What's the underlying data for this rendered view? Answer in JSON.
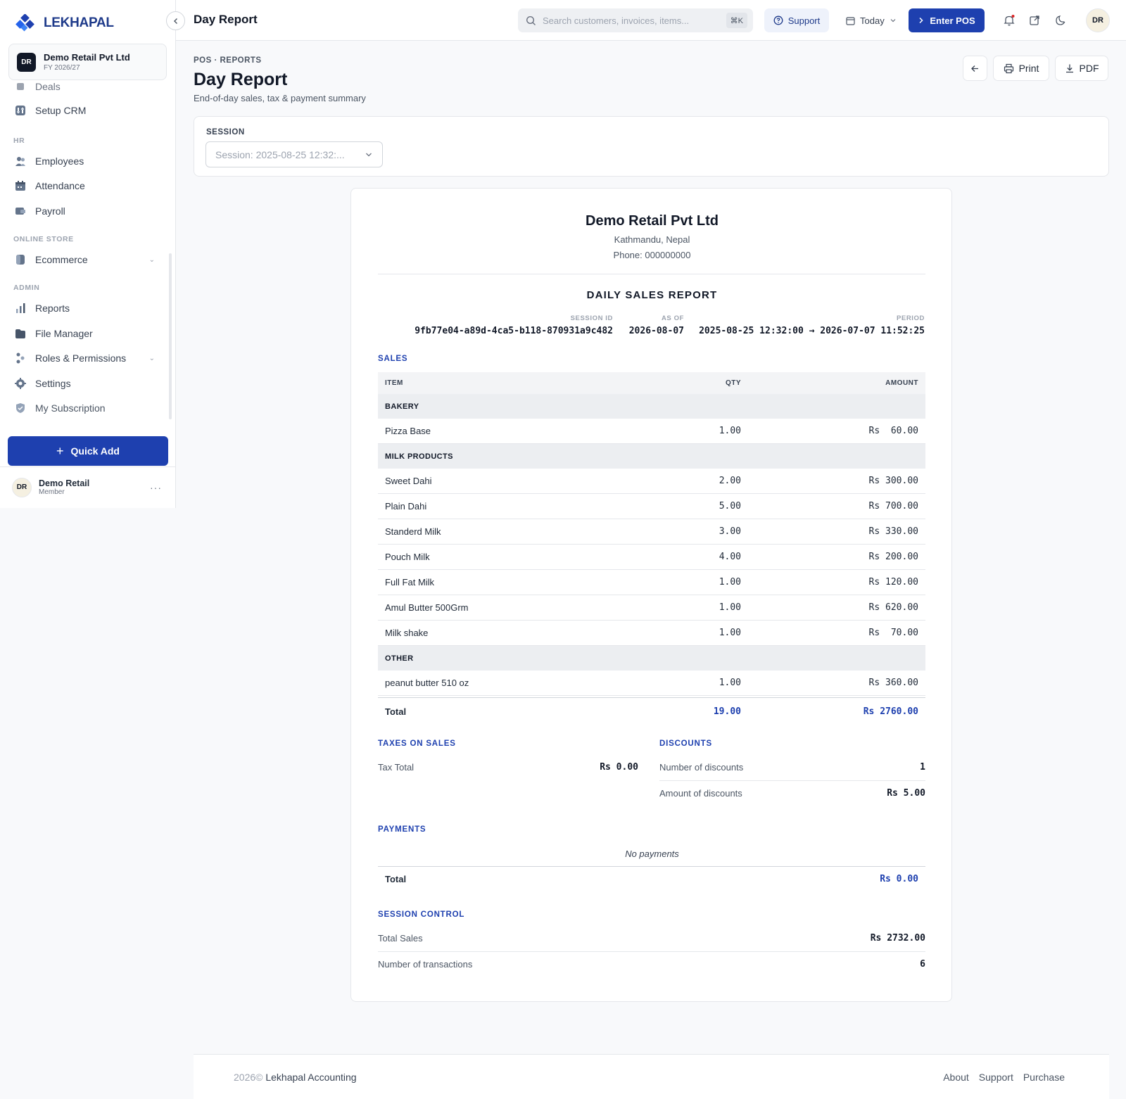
{
  "app": {
    "logo_text": "LEKHAPAL",
    "brand_color": "#1e40af"
  },
  "org": {
    "avatar": "DR",
    "name": "Demo Retail Pvt Ltd",
    "fy": "FY 2026/27"
  },
  "sidebar": {
    "partial_item": "Deals",
    "items_crm": [
      {
        "label": "Setup CRM",
        "icon": "sliders-icon"
      }
    ],
    "section_hr": "HR",
    "items_hr": [
      {
        "label": "Employees",
        "icon": "users-icon"
      },
      {
        "label": "Attendance",
        "icon": "calendar-icon"
      },
      {
        "label": "Payroll",
        "icon": "wallet-icon"
      }
    ],
    "section_store": "ONLINE STORE",
    "items_store": [
      {
        "label": "Ecommerce",
        "icon": "store-icon",
        "expandable": true
      }
    ],
    "section_admin": "ADMIN",
    "items_admin": [
      {
        "label": "Reports",
        "icon": "bar-chart-icon"
      },
      {
        "label": "File Manager",
        "icon": "folder-icon"
      },
      {
        "label": "Roles & Permissions",
        "icon": "key-icon",
        "expandable": true
      },
      {
        "label": "Settings",
        "icon": "gear-icon"
      },
      {
        "label": "My Subscription",
        "icon": "shield-icon"
      }
    ],
    "quick_add": "Quick Add",
    "user": {
      "avatar": "DR",
      "name": "Demo Retail",
      "role": "Member"
    }
  },
  "topbar": {
    "title": "Day Report",
    "search_placeholder": "Search customers, invoices, items...",
    "shortcut": "⌘K",
    "support": "Support",
    "date_filter": "Today",
    "enter_pos": "Enter POS",
    "avatar": "DR"
  },
  "page": {
    "breadcrumb": "POS · REPORTS",
    "title": "Day Report",
    "subtitle": "End-of-day sales, tax & payment summary",
    "print": "Print",
    "pdf": "PDF"
  },
  "session": {
    "label": "SESSION",
    "selected": "Session: 2025-08-25 12:32:..."
  },
  "report": {
    "company": "Demo Retail Pvt Ltd",
    "address": "Kathmandu, Nepal",
    "phone": "Phone: 000000000",
    "title": "DAILY SALES REPORT",
    "meta": {
      "session_id_label": "SESSION ID",
      "session_id": "9fb77e04-a89d-4ca5-b118-870931a9c482",
      "as_of_label": "AS OF",
      "as_of": "2026-08-07",
      "period_label": "PERIOD",
      "period": "2025-08-25 12:32:00 → 2026-07-07 11:52:25"
    },
    "sales": {
      "heading": "SALES",
      "headers": {
        "item": "ITEM",
        "qty": "QTY",
        "amount": "AMOUNT"
      },
      "rows": [
        {
          "type": "group",
          "label": "BAKERY"
        },
        {
          "type": "item",
          "item": "Pizza Base",
          "qty": "1.00",
          "amount": "Rs  60.00"
        },
        {
          "type": "group",
          "label": "MILK PRODUCTS"
        },
        {
          "type": "item",
          "item": "Sweet Dahi",
          "qty": "2.00",
          "amount": "Rs 300.00"
        },
        {
          "type": "item",
          "item": "Plain Dahi",
          "qty": "5.00",
          "amount": "Rs 700.00"
        },
        {
          "type": "item",
          "item": "Standerd Milk",
          "qty": "3.00",
          "amount": "Rs 330.00"
        },
        {
          "type": "item",
          "item": "Pouch Milk",
          "qty": "4.00",
          "amount": "Rs 200.00"
        },
        {
          "type": "item",
          "item": "Full Fat Milk",
          "qty": "1.00",
          "amount": "Rs 120.00"
        },
        {
          "type": "item",
          "item": "Amul Butter 500Grm",
          "qty": "1.00",
          "amount": "Rs 620.00"
        },
        {
          "type": "item",
          "item": "Milk shake",
          "qty": "1.00",
          "amount": "Rs  70.00"
        },
        {
          "type": "group",
          "label": "OTHER"
        },
        {
          "type": "item",
          "item": "peanut butter 510 oz",
          "qty": "1.00",
          "amount": "Rs 360.00"
        }
      ],
      "total_label": "Total",
      "total_qty": "19.00",
      "total_amount": "Rs 2760.00"
    },
    "taxes": {
      "heading": "TAXES ON SALES",
      "label": "Tax Total",
      "value": "Rs 0.00"
    },
    "discounts": {
      "heading": "DISCOUNTS",
      "count_label": "Number of discounts",
      "count": "1",
      "amount_label": "Amount of discounts",
      "amount": "Rs 5.00"
    },
    "payments": {
      "heading": "PAYMENTS",
      "empty": "No payments",
      "total_label": "Total",
      "total": "Rs 0.00"
    },
    "session_control": {
      "heading": "SESSION CONTROL",
      "sales_label": "Total Sales",
      "sales": "Rs 2732.00",
      "tx_label": "Number of transactions",
      "tx": "6"
    }
  },
  "footer": {
    "year": "2026©",
    "company": "Lekhapal Accounting",
    "links": [
      "About",
      "Support",
      "Purchase"
    ]
  }
}
